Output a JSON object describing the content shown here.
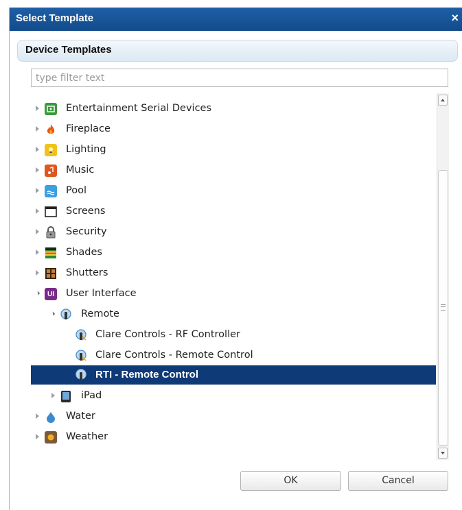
{
  "dialog": {
    "title": "Select Template",
    "close_glyph": "×"
  },
  "section": {
    "title": "Device Templates"
  },
  "filter": {
    "placeholder": "type filter text",
    "value": ""
  },
  "tree": {
    "items": [
      {
        "label": "Entertainment Serial Devices",
        "icon": "entertainment-serial-icon",
        "color": "#3a9a3a",
        "expanded": false
      },
      {
        "label": "Fireplace",
        "icon": "flame-icon",
        "color": "#e8561c",
        "expanded": false
      },
      {
        "label": "Lighting",
        "icon": "lightbulb-icon",
        "color": "#f2c21a",
        "expanded": false
      },
      {
        "label": "Music",
        "icon": "music-note-icon",
        "color": "#e0561e",
        "expanded": false
      },
      {
        "label": "Pool",
        "icon": "pool-icon",
        "color": "#3aa0e0",
        "expanded": false
      },
      {
        "label": "Screens",
        "icon": "projector-screen-icon",
        "color": "#333333",
        "expanded": false
      },
      {
        "label": "Security",
        "icon": "padlock-icon",
        "color": "#888888",
        "expanded": false
      },
      {
        "label": "Shades",
        "icon": "shades-icon",
        "color": "#2f8a2f",
        "expanded": false
      },
      {
        "label": "Shutters",
        "icon": "shutters-icon",
        "color": "#5a3a1a",
        "expanded": false
      },
      {
        "label": "User Interface",
        "icon": "ui-icon",
        "color": "#7a2a8a",
        "icon_text": "UI",
        "expanded": true
      },
      {
        "label": "Remote",
        "icon": "remote-icon",
        "color": "#4a90c8",
        "expanded": true
      },
      {
        "label": "Clare Controls - RF Controller",
        "icon": "remote-icon",
        "color": "#4a90c8"
      },
      {
        "label": "Clare Controls - Remote Control",
        "icon": "remote-icon",
        "color": "#4a90c8"
      },
      {
        "label": "RTI - Remote Control",
        "icon": "remote-icon",
        "color": "#4a90c8",
        "selected": true
      },
      {
        "label": "iPad",
        "icon": "tablet-icon",
        "color": "#333333",
        "expanded": false
      },
      {
        "label": "Water",
        "icon": "water-drop-icon",
        "color": "#3a8ad0",
        "expanded": false
      },
      {
        "label": "Weather",
        "icon": "weather-icon",
        "color": "#f09a1a",
        "expanded": false
      }
    ]
  },
  "buttons": {
    "ok": "OK",
    "cancel": "Cancel"
  },
  "colors": {
    "titlebar": "#1a56a0",
    "selection": "#0f3a78"
  }
}
